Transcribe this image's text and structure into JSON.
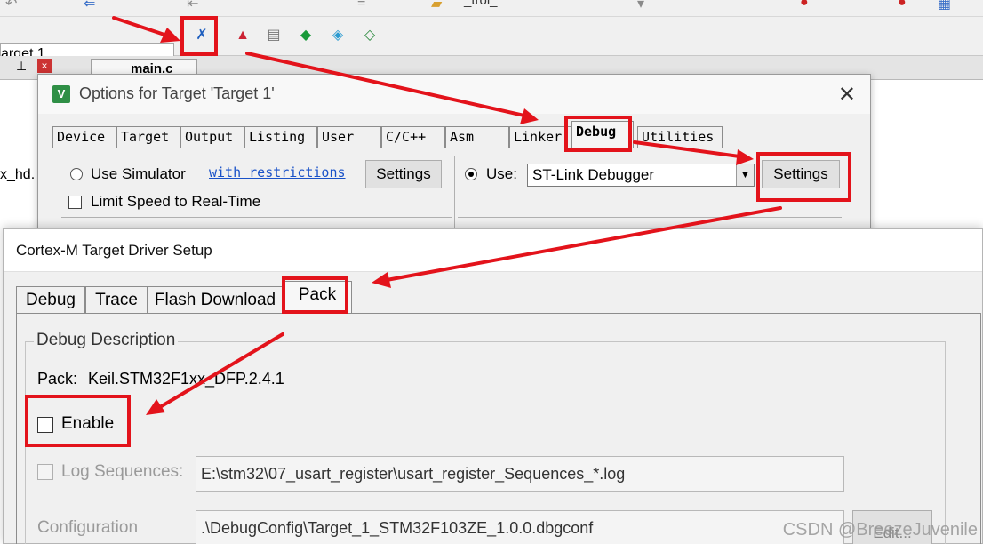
{
  "ide": {
    "target_combo": "arget 1",
    "file_tab": "main.c",
    "left_partial": "x_hd.",
    "partial_combo": "_trol_",
    "pin_icon": "pushpin-icon",
    "close_icon": "close-icon"
  },
  "options_dialog": {
    "title": "Options for Target 'Target 1'",
    "icon": "keil-uvision-icon",
    "tabs": [
      "Device",
      "Target",
      "Output",
      "Listing",
      "User",
      "C/C++",
      "Asm",
      "Linker",
      "Debug",
      "Utilities"
    ],
    "active_tab": "Debug",
    "use_simulator_label": "Use Simulator",
    "with_restrictions_link": "with restrictions",
    "left_settings_button": "Settings",
    "limit_speed_label": "Limit Speed to Real-Time",
    "use_label": "Use:",
    "debugger_value": "ST-Link Debugger",
    "right_settings_button": "Settings"
  },
  "cortex_dialog": {
    "title": "Cortex-M Target Driver Setup",
    "tabs": [
      "Debug",
      "Trace",
      "Flash Download",
      "Pack"
    ],
    "active_tab": "Pack",
    "group_title": "Debug Description",
    "pack_label": "Pack:",
    "pack_value": "Keil.STM32F1xx_DFP.2.4.1",
    "enable_label": "Enable",
    "enable_checked": false,
    "log_sequences_label": "Log Sequences:",
    "log_sequences_value": "E:\\stm32\\07_usart_register\\usart_register_Sequences_*.log",
    "configuration_label": "Configuration",
    "configuration_value": ".\\DebugConfig\\Target_1_STM32F103ZE_1.0.0.dbgconf",
    "edit_button": "Edit..."
  },
  "annotation_color": "#e3131b",
  "watermark": "CSDN @BreezeJuvenile"
}
